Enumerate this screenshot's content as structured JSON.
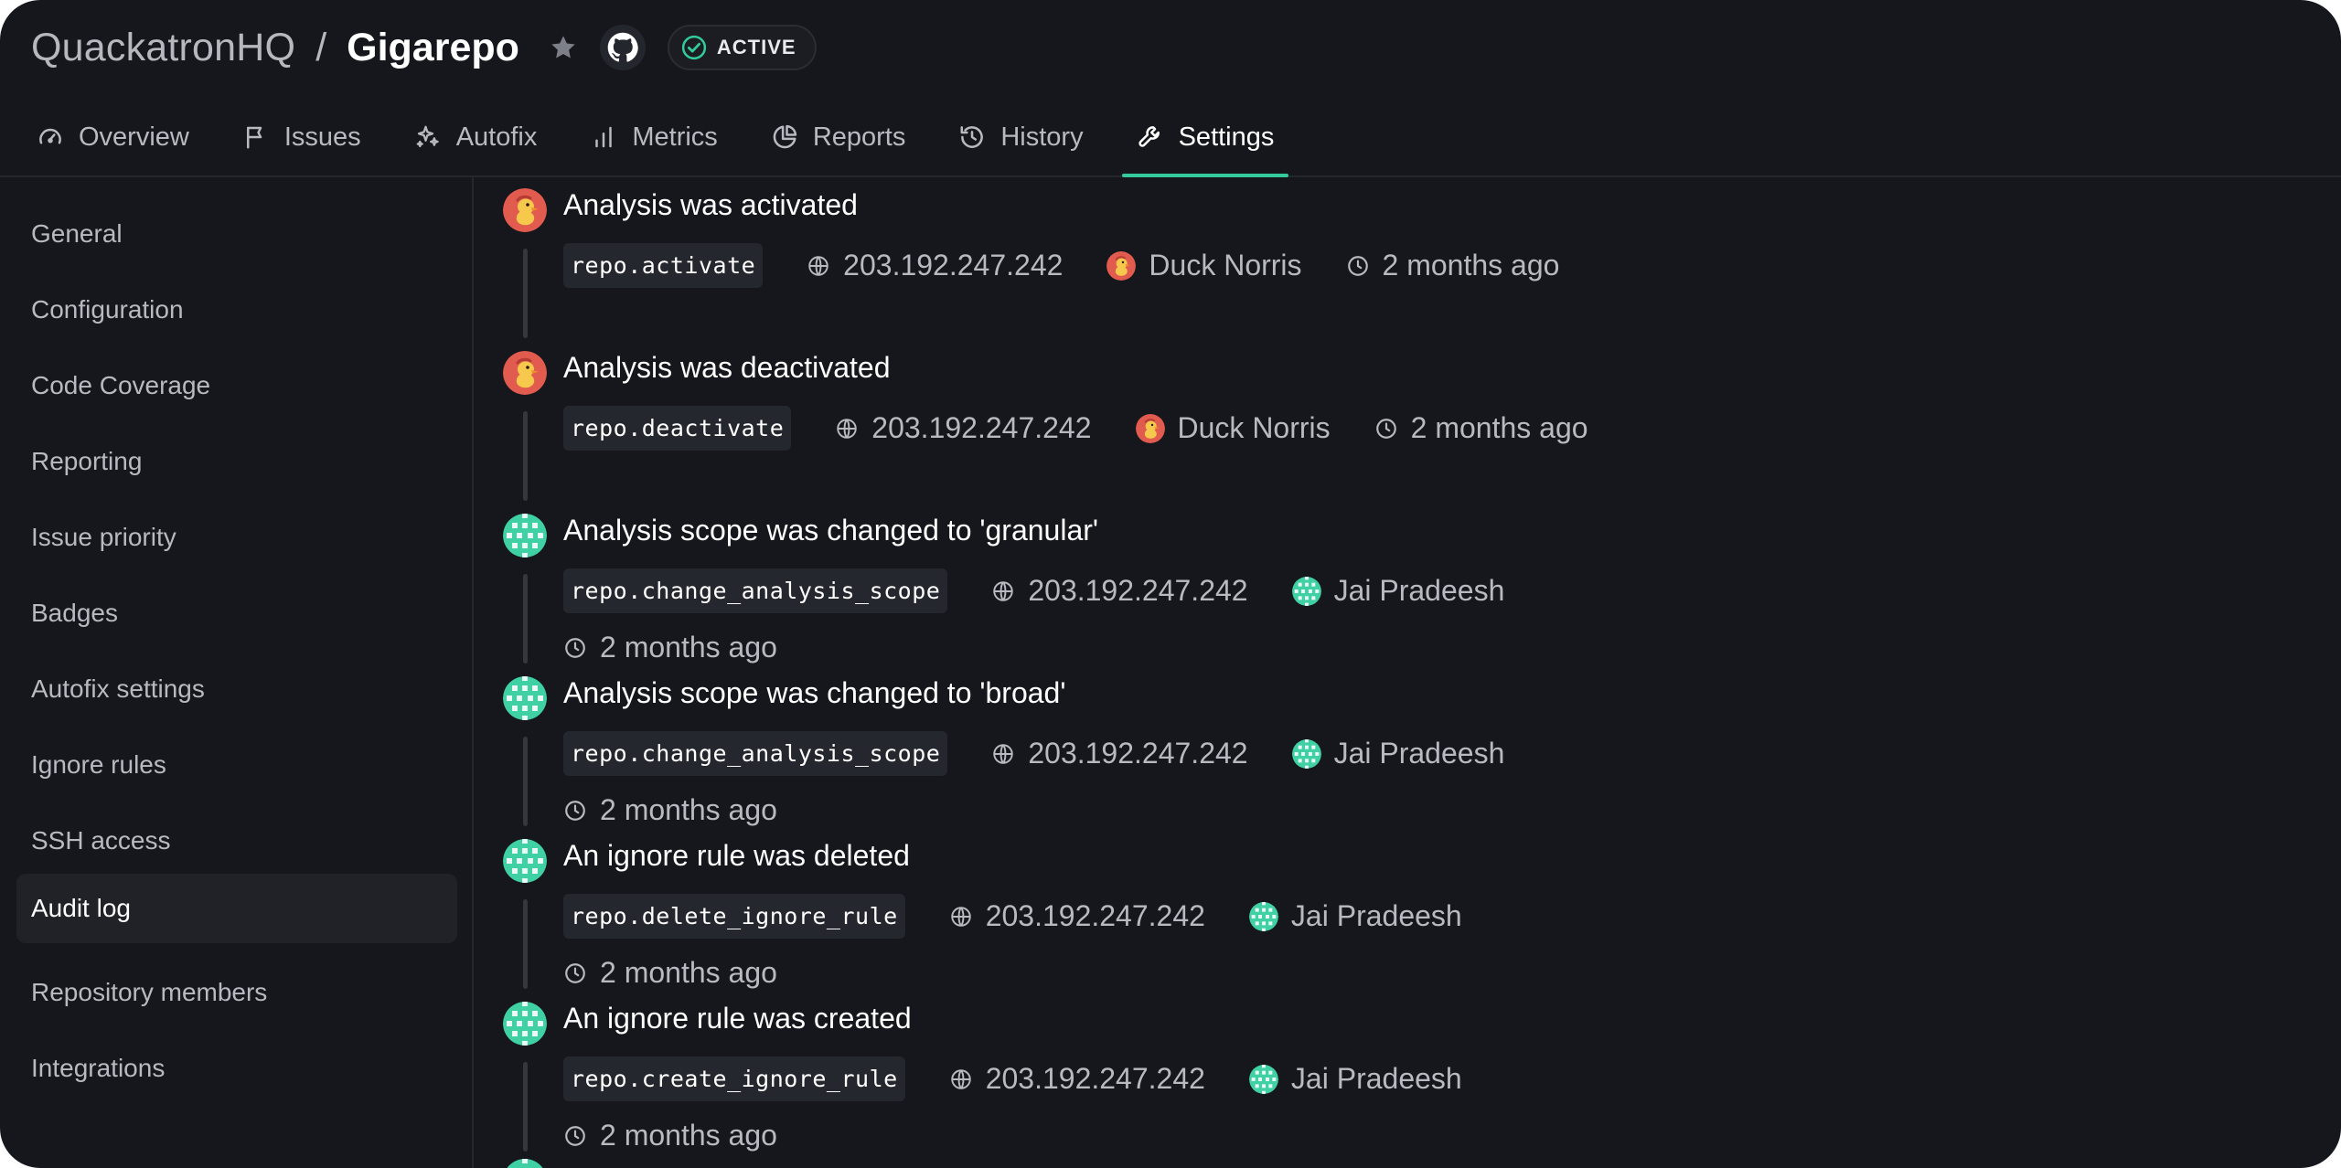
{
  "header": {
    "org": "QuackatronHQ",
    "separator": "/",
    "repo": "Gigarepo",
    "status_badge": "ACTIVE"
  },
  "tabs": [
    {
      "label": "Overview",
      "icon": "gauge-icon"
    },
    {
      "label": "Issues",
      "icon": "flag-icon"
    },
    {
      "label": "Autofix",
      "icon": "sparkle-icon"
    },
    {
      "label": "Metrics",
      "icon": "bar-chart-icon"
    },
    {
      "label": "Reports",
      "icon": "pie-chart-icon"
    },
    {
      "label": "History",
      "icon": "history-icon"
    },
    {
      "label": "Settings",
      "icon": "wrench-icon",
      "active": true
    }
  ],
  "sidebar": {
    "items": [
      {
        "label": "General"
      },
      {
        "label": "Configuration"
      },
      {
        "label": "Code Coverage"
      },
      {
        "label": "Reporting"
      },
      {
        "label": "Issue priority"
      },
      {
        "label": "Badges"
      },
      {
        "label": "Autofix settings"
      },
      {
        "label": "Ignore rules"
      },
      {
        "label": "SSH access"
      },
      {
        "label": "Audit log",
        "active": true
      },
      {
        "label": "Repository members"
      },
      {
        "label": "Integrations"
      }
    ]
  },
  "audit_log": {
    "entries": [
      {
        "title": "Analysis was activated",
        "event": "repo.activate",
        "ip": "203.192.247.242",
        "user": "Duck Norris",
        "avatar": "duck-avatar",
        "time": "2 months ago"
      },
      {
        "title": "Analysis was deactivated",
        "event": "repo.deactivate",
        "ip": "203.192.247.242",
        "user": "Duck Norris",
        "avatar": "duck-avatar",
        "time": "2 months ago"
      },
      {
        "title": "Analysis scope was changed to 'granular'",
        "event": "repo.change_analysis_scope",
        "ip": "203.192.247.242",
        "user": "Jai Pradeesh",
        "avatar": "pattern-avatar",
        "time": "2 months ago"
      },
      {
        "title": "Analysis scope was changed to 'broad'",
        "event": "repo.change_analysis_scope",
        "ip": "203.192.247.242",
        "user": "Jai Pradeesh",
        "avatar": "pattern-avatar",
        "time": "2 months ago"
      },
      {
        "title": "An ignore rule was deleted",
        "event": "repo.delete_ignore_rule",
        "ip": "203.192.247.242",
        "user": "Jai Pradeesh",
        "avatar": "pattern-avatar",
        "time": "2 months ago"
      },
      {
        "title": "An ignore rule was created",
        "event": "repo.create_ignore_rule",
        "ip": "203.192.247.242",
        "user": "Jai Pradeesh",
        "avatar": "pattern-avatar",
        "time": "2 months ago"
      }
    ]
  },
  "colors": {
    "background": "#16171c",
    "accent": "#33cb9a",
    "duck_avatar": "#e25b4f",
    "pattern_avatar": "#3fd0a3"
  }
}
